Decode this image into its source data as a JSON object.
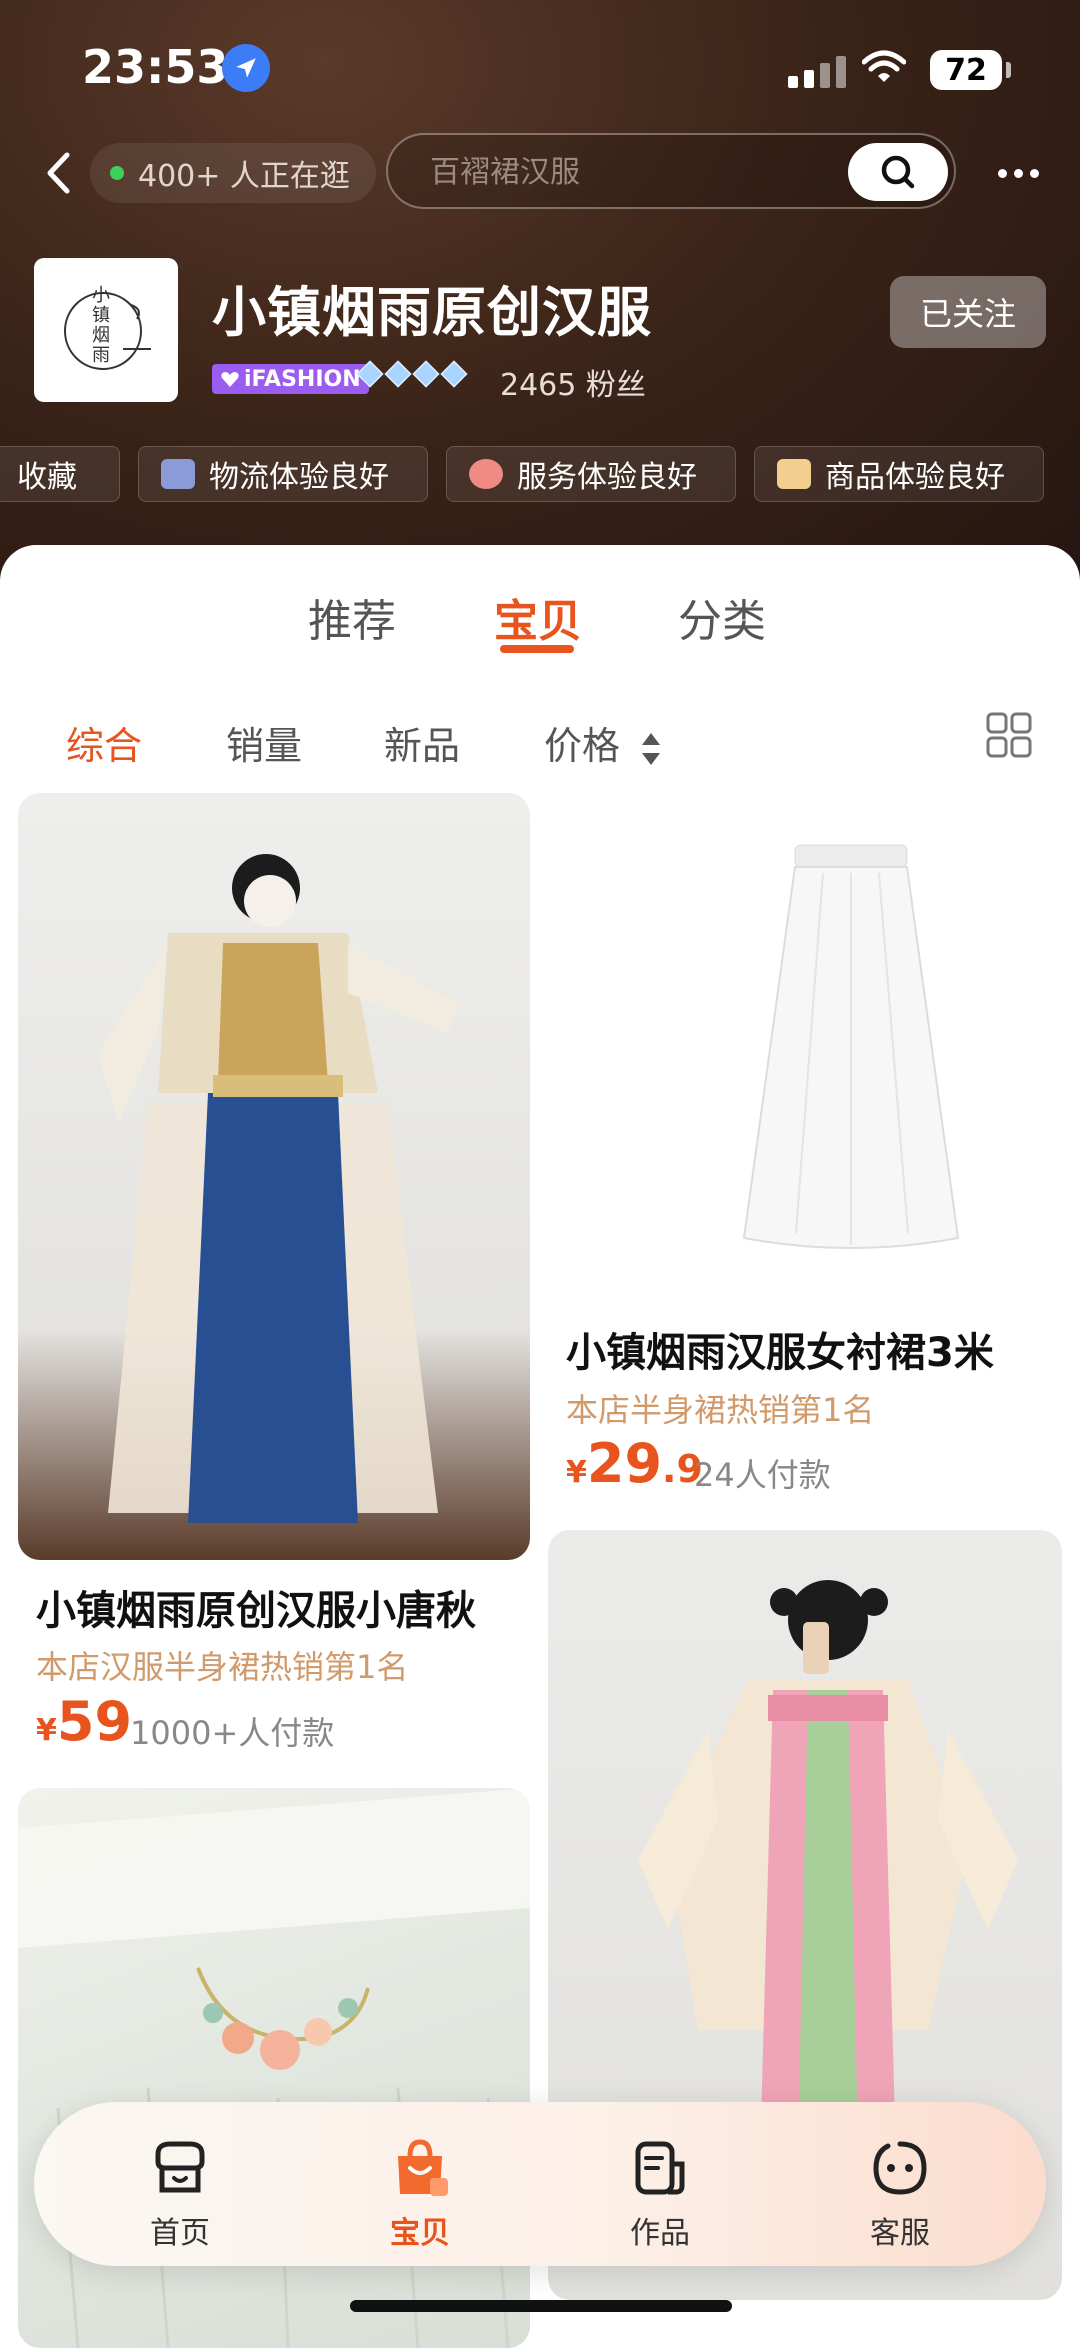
{
  "status_bar": {
    "time": "23:53",
    "battery": "72"
  },
  "nav": {
    "online_count": "400+ 人正在逛",
    "search_placeholder": "百褶裙汉服"
  },
  "shop": {
    "logo_text": "小镇烟雨",
    "name": "小镇烟雨原创汉服",
    "tier_badge": "iFASHION",
    "fans": "2465 粉丝",
    "follow_label": "已关注"
  },
  "badges": [
    "收藏",
    "物流体验良好",
    "服务体验良好",
    "商品体验良好"
  ],
  "tabs": [
    "推荐",
    "宝贝",
    "分类"
  ],
  "active_tab": "宝贝",
  "filters": [
    "综合",
    "销量",
    "新品",
    "价格"
  ],
  "products": [
    {
      "title": "小镇烟雨原创汉服小唐秋",
      "rank": "本店汉服半身裙热销第1名",
      "price_yen": "¥",
      "price_int": "59",
      "price_dec": "",
      "sold": "1000+人付款"
    },
    {
      "title": "小镇烟雨汉服女衬裙3米",
      "rank": "本店半身裙热销第1名",
      "price_yen": "¥",
      "price_int": "29",
      "price_dec": ".9",
      "sold": "24人付款"
    }
  ],
  "bottom_nav": [
    "首页",
    "宝贝",
    "作品",
    "客服"
  ],
  "colors": {
    "accent": "#e8541e",
    "header_bg": "#3b2418",
    "rank_text": "#d09a6b"
  }
}
